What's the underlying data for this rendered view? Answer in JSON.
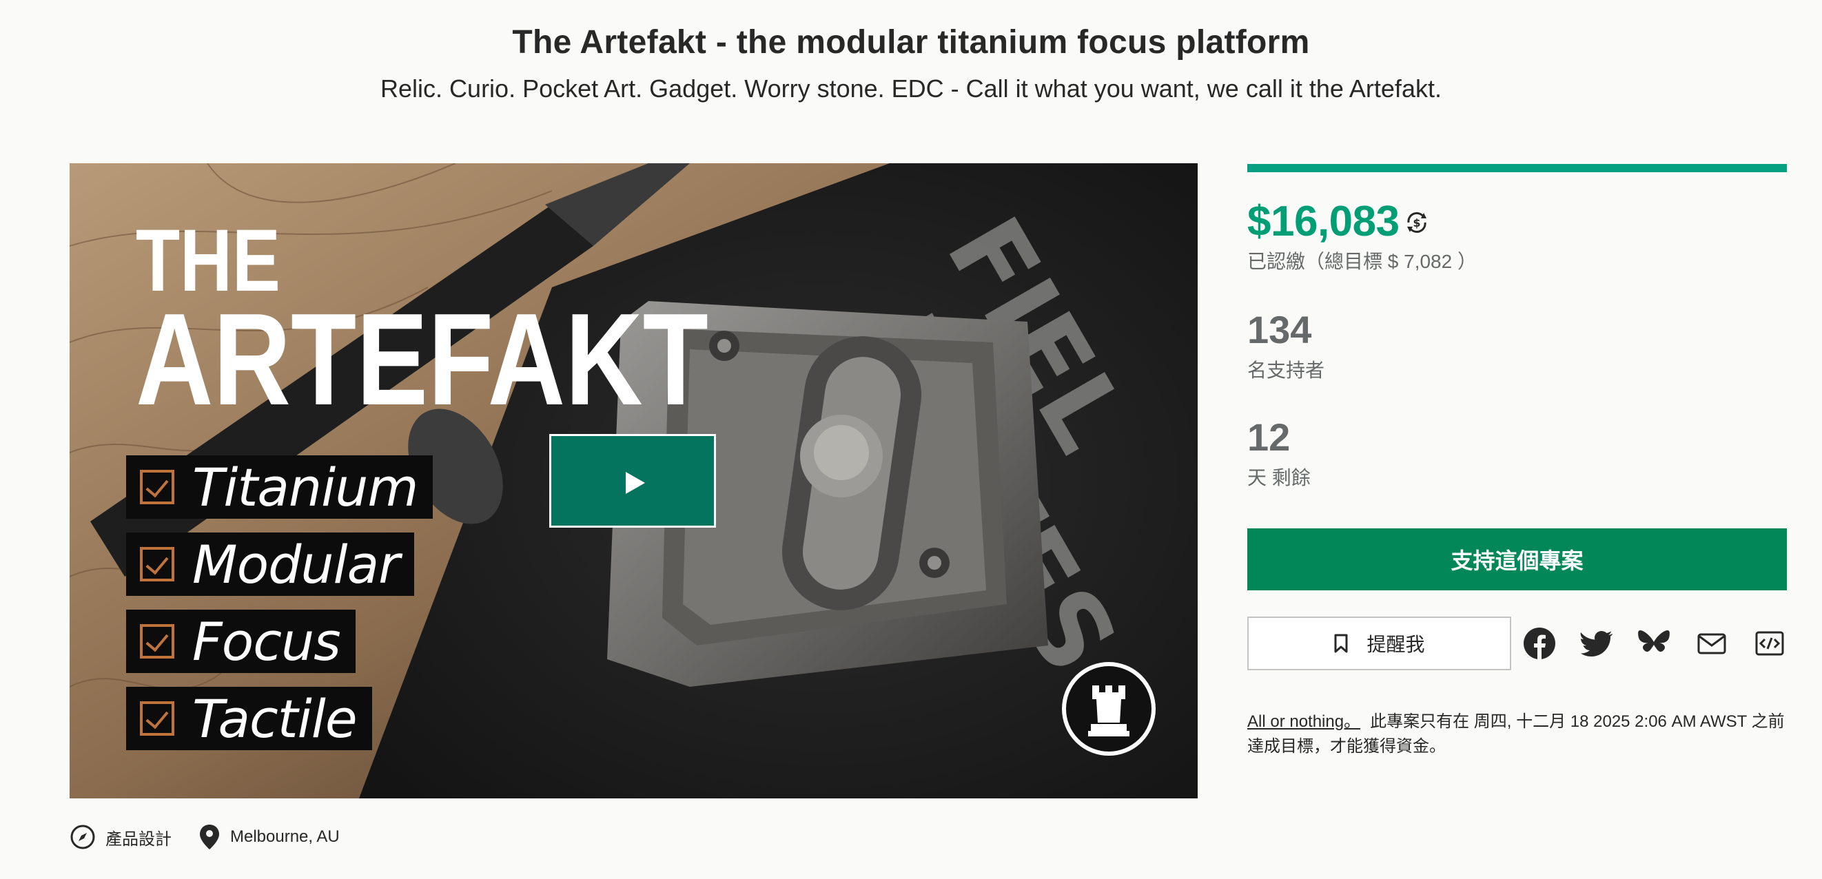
{
  "header": {
    "title": "The Artefakt - the modular titanium focus platform",
    "subtitle": "Relic. Curio. Pocket Art. Gadget. Worry stone. EDC - Call it what you want, we call it the Artefakt."
  },
  "hero": {
    "title_line1": "THE",
    "title_line2": "ARTEFAKT",
    "features": [
      "Titanium",
      "Modular",
      "Focus",
      "Tactile"
    ],
    "play_icon": "play-icon",
    "logo_icon": "rook-logo-icon"
  },
  "campaign": {
    "progress_fraction": 1.0,
    "pledged": "$16,083",
    "currency_icon": "currency-convert-icon",
    "goal_text": "已認繳（總目標 $ 7,082 ）",
    "backers_count": "134",
    "backers_label": "名支持者",
    "days_count": "12",
    "days_label": "天 剩餘",
    "back_button": "支持這個專案",
    "remind_button": "提醒我",
    "share_icons": [
      "facebook-icon",
      "twitter-icon",
      "bluesky-icon",
      "email-icon",
      "embed-icon"
    ],
    "all_or_nothing_link": "All or nothing。",
    "all_or_nothing_text": "此專案只有在 周四, 十二月 18 2025 2:06 AM AWST 之前達成目標，才能獲得資金。"
  },
  "meta": {
    "category": "產品設計",
    "location": "Melbourne, AU"
  },
  "colors": {
    "accent_green": "#009e74",
    "button_green": "#028858",
    "play_button": "#05745e",
    "muted_text": "#656969"
  }
}
